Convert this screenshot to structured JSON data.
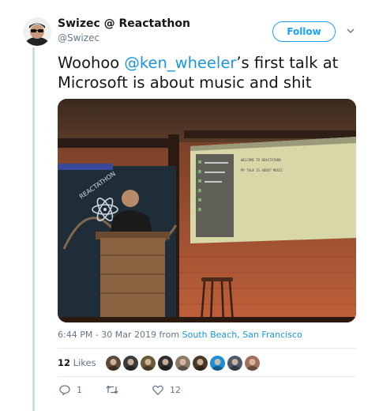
{
  "author": {
    "name": "Swizec @ Reactathon",
    "handle": "@Swizec"
  },
  "follow_label": "Follow",
  "tweet": {
    "prefix": "Woohoo ",
    "mention": "@ken_wheeler",
    "suffix": "’s first talk at Microsoft is about music and shit"
  },
  "photo": {
    "sign_text": "REACTATHON",
    "slide_title": "WELCOME TO REACTATHON",
    "slide_subtitle": "MY TALK IS ABOUT MUSIC"
  },
  "meta": {
    "timestamp": "6:44 PM - 30 Mar 2019 from ",
    "location": "South Beach, San Francisco"
  },
  "likes": {
    "count": "12",
    "label": "Likes",
    "liker_colors": [
      "#5b4a3a",
      "#3b3b3b",
      "#6b5a3a",
      "#2f2f2f",
      "#8a7a6a",
      "#4a3a2a",
      "#1d8fd8",
      "#4a5a6a",
      "#a0705a"
    ]
  },
  "actions": {
    "replies": "1",
    "retweets": "",
    "likes": "12"
  },
  "colors": {
    "accent": "#1da1f2",
    "link": "#1b95e0",
    "muted": "#657786"
  },
  "icons": [
    "chevron-down-icon",
    "reply-icon",
    "retweet-icon",
    "heart-icon"
  ]
}
